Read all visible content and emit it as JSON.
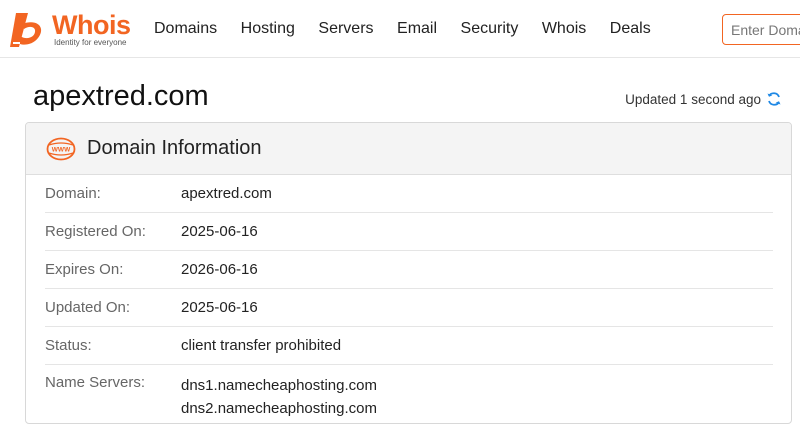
{
  "brand": {
    "name_prefix": "Who",
    "name_suffix": "is",
    "tagline": "Identity for everyone",
    "color": "#f26522"
  },
  "nav": {
    "items": [
      "Domains",
      "Hosting",
      "Servers",
      "Email",
      "Security",
      "Whois",
      "Deals"
    ]
  },
  "search": {
    "placeholder": "Enter Domain or IP"
  },
  "page": {
    "title": "apextred.com",
    "updated_text": "Updated 1 second ago",
    "refresh_icon": "refresh-icon",
    "accent_blue": "#1e88e5"
  },
  "card": {
    "title": "Domain Information",
    "icon": "www-icon",
    "rows": [
      {
        "label": "Domain:",
        "values": [
          "apextred.com"
        ]
      },
      {
        "label": "Registered On:",
        "values": [
          "2025-06-16"
        ]
      },
      {
        "label": "Expires On:",
        "values": [
          "2026-06-16"
        ]
      },
      {
        "label": "Updated On:",
        "values": [
          "2025-06-16"
        ]
      },
      {
        "label": "Status:",
        "values": [
          "client transfer prohibited"
        ]
      },
      {
        "label": "Name Servers:",
        "values": [
          "dns1.namecheaphosting.com",
          "dns2.namecheaphosting.com"
        ]
      }
    ]
  }
}
